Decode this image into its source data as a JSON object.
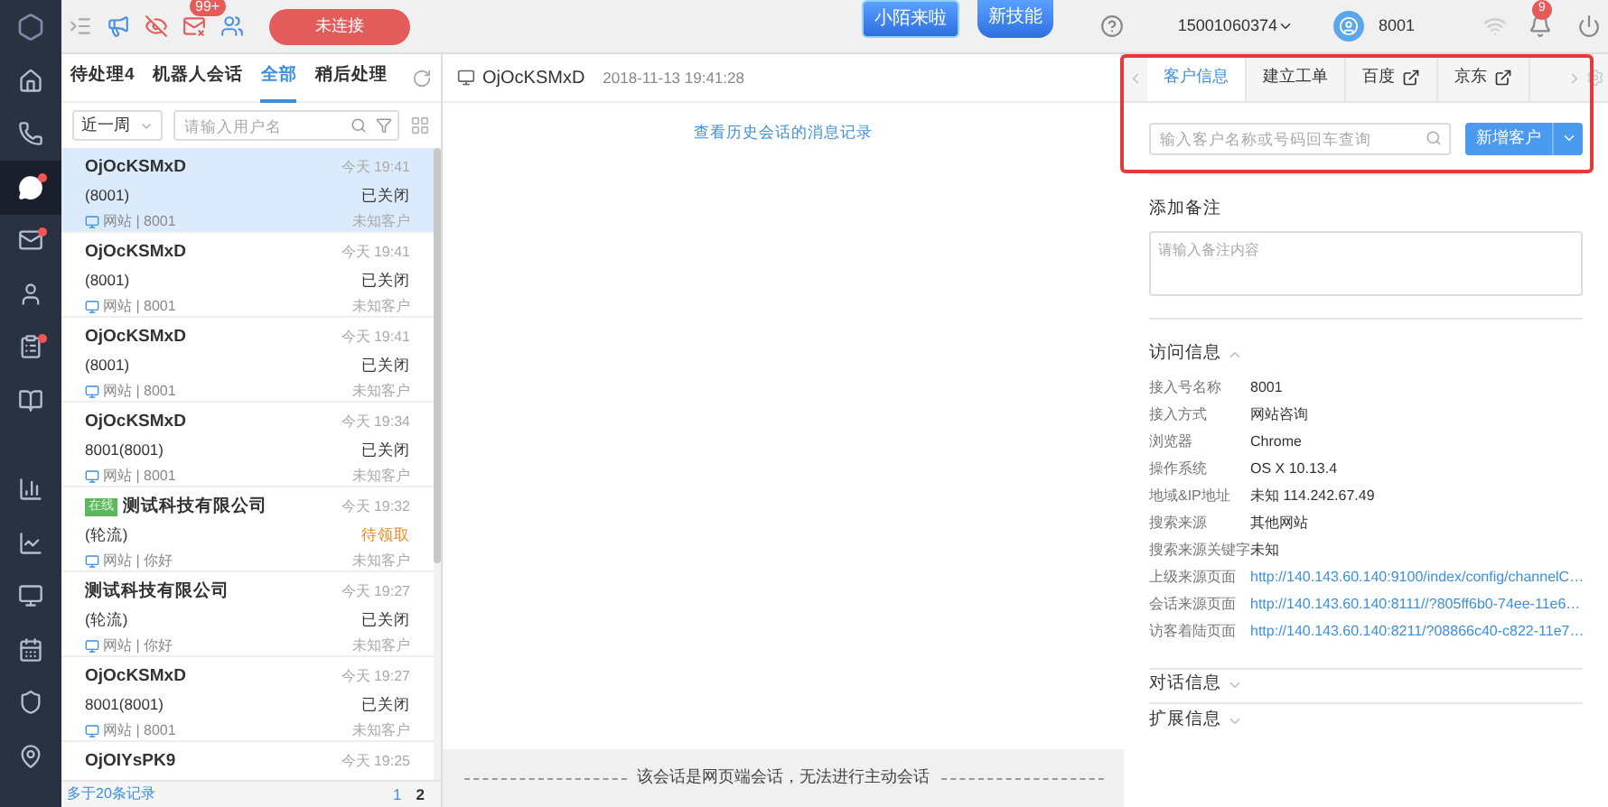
{
  "toolbar": {
    "mail_badge": "99+",
    "connect_button": "未连接",
    "promo_badges": [
      "小陌来啦",
      "新技能"
    ],
    "phone": "15001060374",
    "agent": "8001",
    "notify_count": "9"
  },
  "nav": [
    {
      "kind": "home",
      "selected": false,
      "dot": false
    },
    {
      "kind": "phone",
      "selected": false,
      "dot": false
    },
    {
      "kind": "chat",
      "selected": true,
      "dot": true
    },
    {
      "kind": "mail",
      "selected": false,
      "dot": true
    },
    {
      "kind": "user",
      "selected": false,
      "dot": false
    },
    {
      "kind": "clipboard",
      "selected": false,
      "dot": true
    },
    {
      "kind": "book",
      "selected": false,
      "dot": false
    },
    {
      "kind": "bars",
      "selected": false,
      "dot": false
    },
    {
      "kind": "chart",
      "selected": false,
      "dot": false
    },
    {
      "kind": "monitor",
      "selected": false,
      "dot": false
    },
    {
      "kind": "calendar",
      "selected": false,
      "dot": false
    },
    {
      "kind": "shield",
      "selected": false,
      "dot": false
    },
    {
      "kind": "pin",
      "selected": false,
      "dot": false
    }
  ],
  "list_tabs": [
    {
      "label": "待处理4",
      "selected": false
    },
    {
      "label": "机器人会话",
      "selected": false
    },
    {
      "label": "全部",
      "selected": true
    },
    {
      "label": "稍后处理",
      "selected": false
    }
  ],
  "filter": {
    "period": "近一周",
    "search_placeholder": "请输入用户名"
  },
  "sessions": [
    {
      "name": "OjOcKSMxD",
      "sub": "(8001)",
      "channel": "网站 | 8001",
      "time": "今天 19:41",
      "status": "已关闭",
      "pending": false,
      "customer": "未知客户",
      "selected": true
    },
    {
      "name": "OjOcKSMxD",
      "sub": "(8001)",
      "channel": "网站 | 8001",
      "time": "今天 19:41",
      "status": "已关闭",
      "pending": false,
      "customer": "未知客户",
      "selected": false
    },
    {
      "name": "OjOcKSMxD",
      "sub": "(8001)",
      "channel": "网站 | 8001",
      "time": "今天 19:41",
      "status": "已关闭",
      "pending": false,
      "customer": "未知客户",
      "selected": false
    },
    {
      "name": "OjOcKSMxD",
      "sub": "8001(8001)",
      "channel": "网站 | 8001",
      "time": "今天 19:34",
      "status": "已关闭",
      "pending": false,
      "customer": "未知客户",
      "selected": false
    },
    {
      "name": "测试科技有限公司",
      "sub": "(轮流)",
      "channel": "网站 | 你好",
      "time": "今天 19:32",
      "status": "待领取",
      "pending": true,
      "customer": "未知客户",
      "online_tag": "在线",
      "selected": false
    },
    {
      "name": "测试科技有限公司",
      "sub": "(轮流)",
      "channel": "网站 | 你好",
      "time": "今天 19:27",
      "status": "已关闭",
      "pending": false,
      "customer": "未知客户",
      "selected": false
    },
    {
      "name": "OjOcKSMxD",
      "sub": "8001(8001)",
      "channel": "网站 | 8001",
      "time": "今天 19:27",
      "status": "已关闭",
      "pending": false,
      "customer": "未知客户",
      "selected": false
    },
    {
      "name": "OjOIYsPK9",
      "time": "今天 19:25",
      "selected": false
    }
  ],
  "list_footer": {
    "count": "多于20条记录",
    "pages": [
      {
        "label": "1",
        "selected": true
      },
      {
        "label": "2",
        "selected": false
      }
    ]
  },
  "chat": {
    "title": "OjOcKSMxD",
    "timestamp": "2018-11-13 19:41:28",
    "history_link": "查看历史会话的消息记录",
    "notice": "该会话是网页端会话，无法进行主动会话"
  },
  "panel_tabs": [
    {
      "label": "客户信息",
      "selected": true,
      "external": false
    },
    {
      "label": "建立工单",
      "selected": false,
      "external": false
    },
    {
      "label": "百度",
      "selected": false,
      "external": true
    },
    {
      "label": "京东",
      "selected": false,
      "external": true
    }
  ],
  "customer_search": {
    "placeholder": "输入客户名称或号码回车查询",
    "add_button": "新增客户"
  },
  "note": {
    "title": "添加备注",
    "placeholder": "请输入备注内容"
  },
  "visit": {
    "title": "访问信息",
    "expanded": true,
    "rows": [
      {
        "label": "接入号名称",
        "value": "8001",
        "kind": "text"
      },
      {
        "label": "接入方式",
        "value": "网站咨询",
        "kind": "text"
      },
      {
        "label": "浏览器",
        "value": "Chrome",
        "kind": "text"
      },
      {
        "label": "操作系统",
        "value": "OS X 10.13.4",
        "kind": "text"
      },
      {
        "label": "地域&IP地址",
        "value": "未知 114.242.67.49",
        "kind": "text"
      },
      {
        "label": "搜索来源",
        "value": "其他网站",
        "kind": "text"
      },
      {
        "label": "搜索来源关键字",
        "value": "未知",
        "kind": "text"
      },
      {
        "label": "上级来源页面",
        "value": "http://140.143.60.140:9100/index/config/channelC…",
        "kind": "link"
      },
      {
        "label": "会话来源页面",
        "value": "http://140.143.60.140:8111//?805ff6b0-74ee-11e6…",
        "kind": "link"
      },
      {
        "label": "访客着陆页面",
        "value": "http://140.143.60.140:8211/?08866c40-c822-11e7…",
        "kind": "link"
      }
    ]
  },
  "sections": [
    {
      "title": "对话信息",
      "expanded": false
    },
    {
      "title": "扩展信息",
      "expanded": false
    }
  ]
}
